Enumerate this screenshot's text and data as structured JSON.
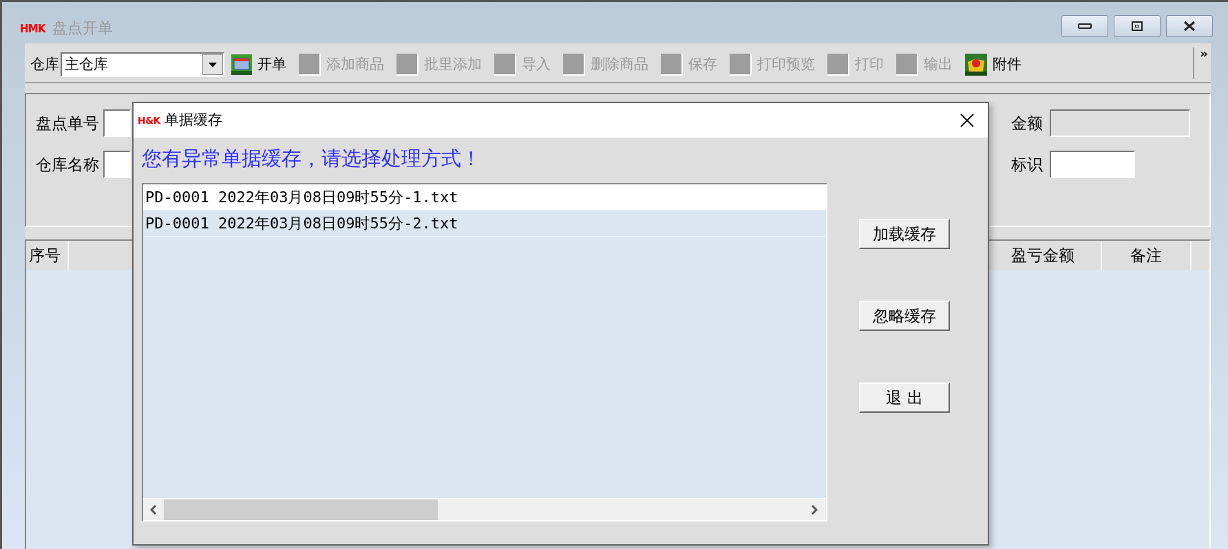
{
  "window": {
    "logo": "HMK",
    "title": "盘点开单"
  },
  "toolbar": {
    "warehouse_label": "仓库",
    "warehouse_value": "主仓库",
    "overflow": "»",
    "items": [
      {
        "label": "开单",
        "disabled": false,
        "kind": "open"
      },
      {
        "label": "添加商品",
        "disabled": true,
        "kind": "plain"
      },
      {
        "label": "批里添加",
        "disabled": true,
        "kind": "plain"
      },
      {
        "label": "导入",
        "disabled": true,
        "kind": "plain"
      },
      {
        "label": "删除商品",
        "disabled": true,
        "kind": "plain"
      },
      {
        "label": "保存",
        "disabled": true,
        "kind": "plain"
      },
      {
        "label": "打印预览",
        "disabled": true,
        "kind": "plain"
      },
      {
        "label": "打印",
        "disabled": true,
        "kind": "plain"
      },
      {
        "label": "输出",
        "disabled": true,
        "kind": "plain"
      },
      {
        "label": "附件",
        "disabled": false,
        "kind": "attach"
      }
    ]
  },
  "form": {
    "left": [
      {
        "label": "盘点单号"
      },
      {
        "label": "仓库名称"
      }
    ],
    "right": [
      {
        "label": "金额",
        "disabled": true
      },
      {
        "label": "标识",
        "disabled": false
      }
    ]
  },
  "grid": {
    "columns": [
      "序号",
      "盈亏金额",
      "备注"
    ]
  },
  "dialog": {
    "logo": "H&K",
    "title": "单据缓存",
    "message": "您有异常单据缓存，请选择处理方式！",
    "files": [
      {
        "name": "PD-0001 2022年03月08日09时55分-1.txt",
        "selected": true
      },
      {
        "name": "PD-0001 2022年03月08日09时55分-2.txt",
        "selected": false
      }
    ],
    "buttons": [
      "加载缓存",
      "忽略缓存",
      "退 出"
    ]
  }
}
